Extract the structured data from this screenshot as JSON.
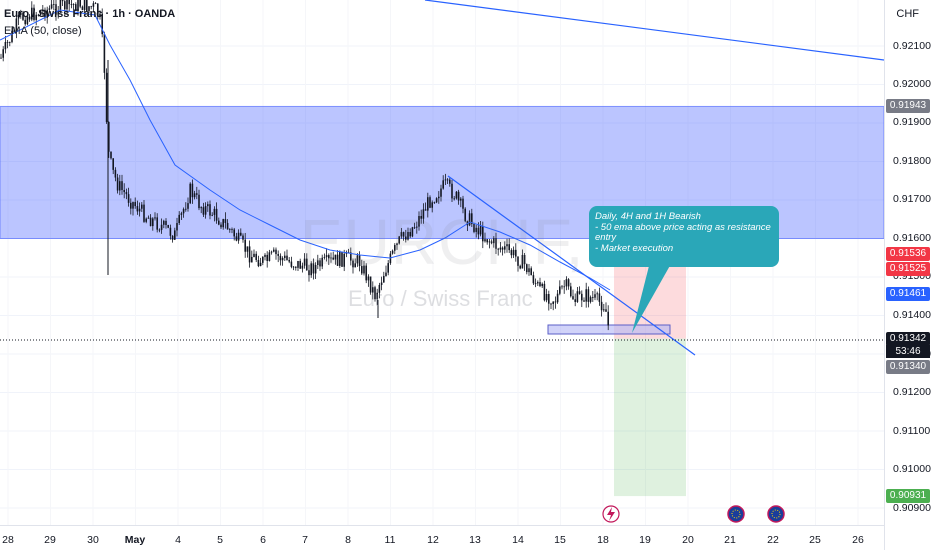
{
  "legend": {
    "symbol": "Euro / Swiss Franc · 1h · OANDA",
    "indicator": "EMA (50, close)"
  },
  "watermark": {
    "ticker": "EURCHF, 1h",
    "name": "Euro / Swiss Franc"
  },
  "price_scale": {
    "currency": "CHF",
    "labels": [
      "0.92100",
      "0.92000",
      "0.91900",
      "0.91800",
      "0.91700",
      "0.91600",
      "0.91500",
      "0.91400",
      "0.91300",
      "0.91200",
      "0.91100",
      "0.91000",
      "0.90900"
    ],
    "tags": {
      "zone_top": "0.91943",
      "stop_loss": "0.91536",
      "entry_high": "0.91525",
      "ema": "0.91461",
      "last_price": "0.91342",
      "countdown": "53:46",
      "entry": "0.91340",
      "take_profit": "0.90931"
    }
  },
  "time_scale": {
    "labels": [
      "28",
      "29",
      "30",
      "May",
      "4",
      "5",
      "6",
      "7",
      "8",
      "11",
      "12",
      "13",
      "14",
      "15",
      "18",
      "19",
      "20",
      "21",
      "22",
      "25",
      "26"
    ]
  },
  "annotation": {
    "lines": [
      "Daily, 4H and 1H Bearish",
      "- 50 ema above price acting as resistance",
      "entry",
      "- Market execution"
    ]
  },
  "colors": {
    "resistance_zone": "#3d5afe",
    "trendline": "#2962ff",
    "candle": "#131722",
    "stop_zone": "#f23645",
    "target_zone": "#4caf50",
    "annotation_bg": "#2aa7b8",
    "ema_tag": "#2962ff",
    "last_price_tag": "#131722"
  },
  "icons": [
    "lightning-event-icon",
    "flag-eu-icon",
    "flag-ch-icon"
  ]
}
